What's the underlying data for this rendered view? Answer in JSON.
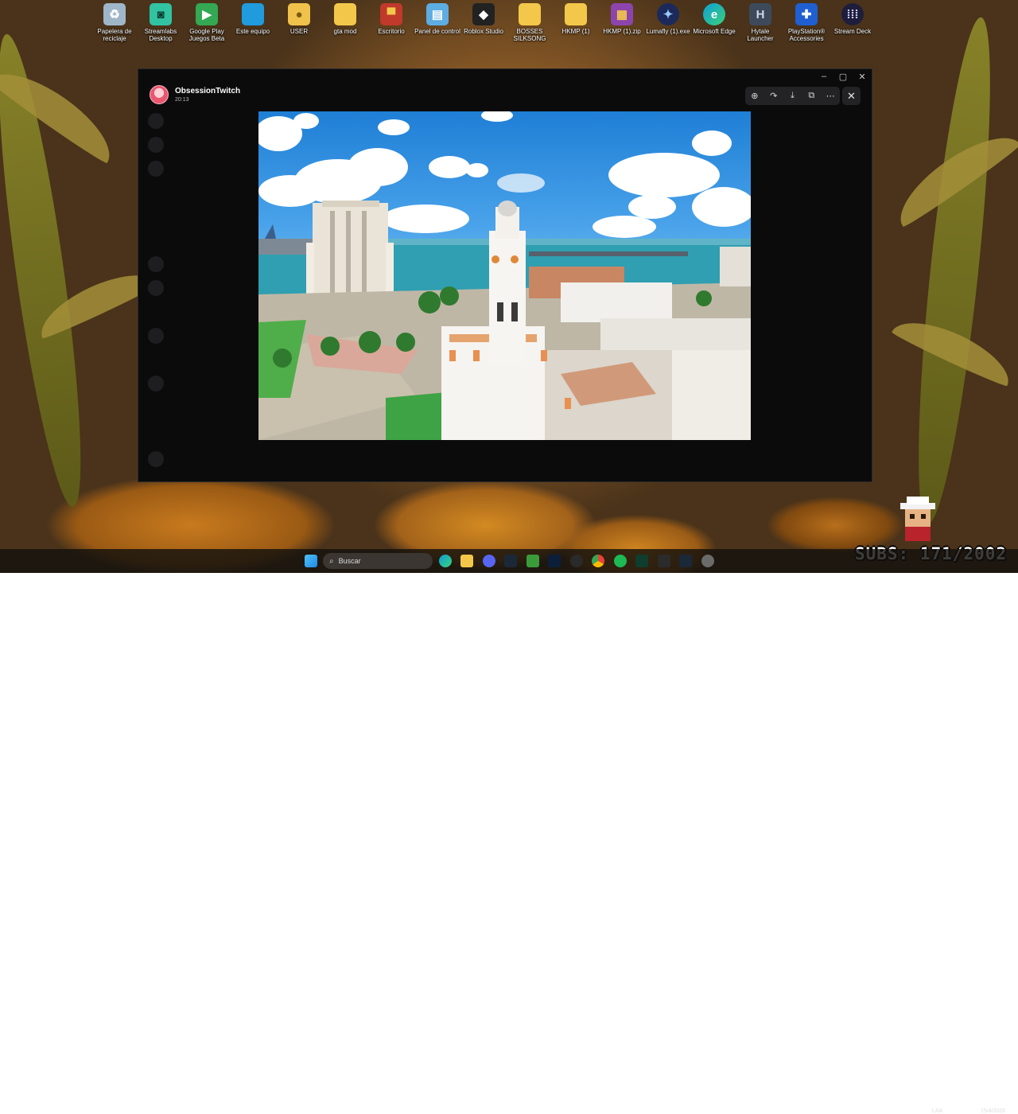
{
  "desktop": {
    "icons": [
      {
        "label": "Papelera de reciclaje",
        "icon": "recycle-bin-icon",
        "color": "#9fb6c9"
      },
      {
        "label": "Streamlabs Desktop",
        "icon": "streamlabs-icon",
        "color": "#31c3a2"
      },
      {
        "label": "Google Play Juegos Beta",
        "icon": "google-play-games-icon",
        "color": "#34a853"
      },
      {
        "label": "Este equipo",
        "icon": "computer-icon",
        "color": "#1f9bde"
      },
      {
        "label": "USER",
        "icon": "user-folder-icon",
        "color": "#f0c14b"
      },
      {
        "label": "gta mod",
        "icon": "folder-icon",
        "color": "#f3c84a"
      },
      {
        "label": "Escritorio",
        "icon": "desktop-folder-icon",
        "color": "#c0392b"
      },
      {
        "label": "Panel de control",
        "icon": "control-panel-icon",
        "color": "#5dade2"
      },
      {
        "label": "Roblox Studio",
        "icon": "roblox-studio-icon",
        "color": "#222222"
      },
      {
        "label": "BOSSES SILKSONG",
        "icon": "folder-icon",
        "color": "#f3c84a"
      },
      {
        "label": "HKMP (1)",
        "icon": "folder-icon",
        "color": "#f3c84a"
      },
      {
        "label": "HKMP (1).zip",
        "icon": "winrar-icon",
        "color": "#8e44ad"
      },
      {
        "label": "Lumafly (1).exe",
        "icon": "lumafly-icon",
        "color": "#1b2a5a"
      },
      {
        "label": "Microsoft Edge",
        "icon": "edge-icon",
        "color": "#0f9ed5"
      },
      {
        "label": "Hytale Launcher",
        "icon": "hytale-icon",
        "color": "#3d4a5c"
      },
      {
        "label": "PlayStation® Accessories",
        "icon": "playstation-icon",
        "color": "#1f5fd1"
      },
      {
        "label": "Stream Deck",
        "icon": "stream-deck-icon",
        "color": "#1e1e3c"
      }
    ]
  },
  "viewer": {
    "uploader_name": "ObsessionTwitch",
    "time": "20:13",
    "toolbar": [
      "zoom-in-icon",
      "forward-icon",
      "download-icon",
      "open-external-icon",
      "more-icon"
    ],
    "close_icon": "close-icon"
  },
  "window": {
    "controls": [
      "minimize-icon",
      "maximize-icon",
      "close-icon"
    ]
  },
  "taskbar": {
    "search_placeholder": "Buscar",
    "language": "LAA",
    "date": "15/4/2026"
  },
  "overlay": {
    "subs_text": "SUBS: 171/2002"
  },
  "colors": {
    "viewer_bg": "#0b0b0c",
    "toolbar_bg": "#232326",
    "taskbar_bg": "#14110e"
  }
}
